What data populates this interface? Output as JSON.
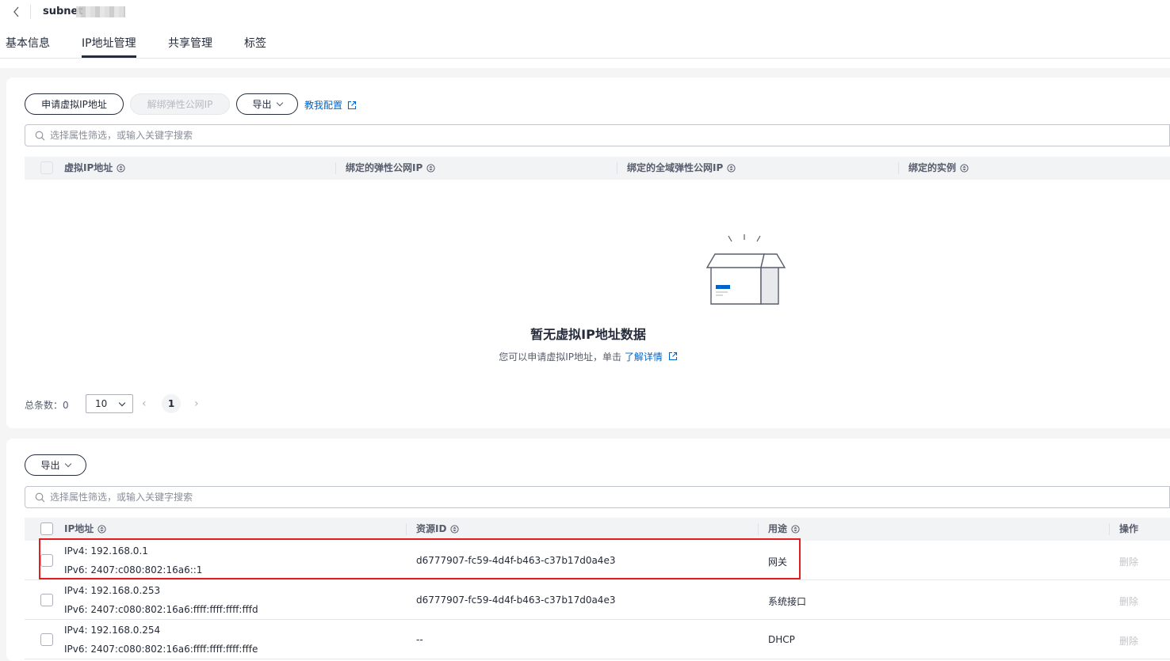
{
  "header": {
    "title": "subnet"
  },
  "tabs": [
    "基本信息",
    "IP地址管理",
    "共享管理",
    "标签"
  ],
  "vip_panel": {
    "buttons": {
      "apply": "申请虚拟IP地址",
      "unbind": "解绑弹性公网IP",
      "export": "导出",
      "guide": "教我配置"
    },
    "search_placeholder": "选择属性筛选，或输入关键字搜索",
    "columns": [
      "虚拟IP地址",
      "绑定的弹性公网IP",
      "绑定的全域弹性公网IP",
      "绑定的实例"
    ],
    "empty": {
      "title": "暂无虚拟IP地址数据",
      "desc": "您可以申请虚拟IP地址，单击",
      "link": "了解详情"
    },
    "pager": {
      "total_label": "总条数：",
      "total": "0",
      "page_size": "10",
      "page": "1"
    }
  },
  "ip_panel": {
    "export": "导出",
    "search_placeholder": "选择属性筛选，或输入关键字搜索",
    "columns": [
      "IP地址",
      "资源ID",
      "用途",
      "操作"
    ],
    "rows": [
      {
        "ipv4": "IPv4: 192.168.0.1",
        "ipv6": "IPv6: 2407:c080:802:16a6::1",
        "resource_id": "d6777907-fc59-4d4f-b463-c37b17d0a4e3",
        "usage": "网关",
        "action": "删除"
      },
      {
        "ipv4": "IPv4: 192.168.0.253",
        "ipv6": "IPv6: 2407:c080:802:16a6:ffff:ffff:ffff:fffd",
        "resource_id": "d6777907-fc59-4d4f-b463-c37b17d0a4e3",
        "usage": "系统接口",
        "action": "删除"
      },
      {
        "ipv4": "IPv4: 192.168.0.254",
        "ipv6": "IPv6: 2407:c080:802:16a6:ffff:ffff:ffff:fffe",
        "resource_id": "--",
        "usage": "DHCP",
        "action": "删除"
      }
    ]
  },
  "colors": {
    "link": "#0064c8",
    "highlight": "#e02020",
    "text": "#252b3a"
  }
}
